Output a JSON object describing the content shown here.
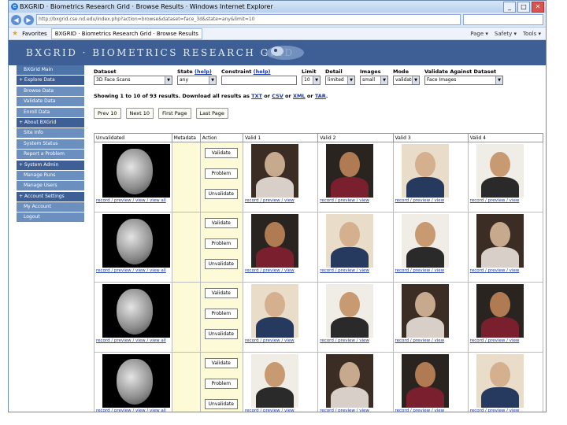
{
  "browser": {
    "window_title": "BXGRID · Biometrics Research Grid · Browse Results · Windows Internet Explorer",
    "url": "http://bxgrid.cse.nd.edu/index.php?action=browse&dataset=face_3d&state=any&limit=10",
    "favorites_label": "Favorites",
    "tab_label": "BXGRID · Biometrics Research Grid · Browse Results",
    "tools": [
      "Page ▾",
      "Safety ▾",
      "Tools ▾"
    ]
  },
  "header": {
    "title": "BXGRID · BIOMETRICS RESEARCH GRID"
  },
  "sidebar": {
    "items": [
      {
        "label": "BXGrid Main",
        "kind": "item"
      },
      {
        "label": "+ Explore Data",
        "kind": "sec"
      },
      {
        "label": "Browse Data",
        "kind": "sub"
      },
      {
        "label": "Validate Data",
        "kind": "sub"
      },
      {
        "label": "Enroll Data",
        "kind": "sub"
      },
      {
        "label": "+ About BXGrid",
        "kind": "sec"
      },
      {
        "label": "Site Info",
        "kind": "sub"
      },
      {
        "label": "System Status",
        "kind": "sub"
      },
      {
        "label": "Report a Problem",
        "kind": "sub"
      },
      {
        "label": "+ System Admin",
        "kind": "sec"
      },
      {
        "label": "Manage Runs",
        "kind": "sub"
      },
      {
        "label": "Manage Users",
        "kind": "sub"
      },
      {
        "label": "+ Account Settings",
        "kind": "sec"
      },
      {
        "label": "My Account",
        "kind": "sub"
      },
      {
        "label": "Logout",
        "kind": "sub"
      }
    ]
  },
  "filters": {
    "dataset": {
      "label": "Dataset",
      "value": "3D Face Scans"
    },
    "state": {
      "label": "State",
      "help": "(help)",
      "value": "any"
    },
    "constraint": {
      "label": "Constraint",
      "help": "(help)",
      "value": ""
    },
    "limit": {
      "label": "Limit",
      "value": "10"
    },
    "detail": {
      "label": "Detail",
      "value": "limited"
    },
    "images": {
      "label": "Images",
      "value": "small"
    },
    "mode": {
      "label": "Mode",
      "value": "validate"
    },
    "validate_against": {
      "label": "Validate Against Dataset",
      "value": "Face Images"
    }
  },
  "results": {
    "showing": "Showing 1 to 10 of 93 results. Download all results as",
    "formats": [
      "TXT",
      "CSV",
      "XML",
      "TAR"
    ]
  },
  "pagination": [
    "Prev 10",
    "Next 10",
    "First Page",
    "Last Page"
  ],
  "table": {
    "headers": [
      "Unvalidated",
      "Metadata",
      "Action",
      "Valid 1",
      "Valid 2",
      "Valid 3",
      "Valid 4"
    ],
    "actions": [
      "Validate",
      "Problem",
      "Unvalidate"
    ],
    "link_text": "record / preview / view / view all",
    "photo_link_text": "record / preview / view"
  },
  "colors": {
    "accent": "#3d5f96",
    "link": "#1a35a8",
    "meta_bg": "#fdfbd7"
  }
}
